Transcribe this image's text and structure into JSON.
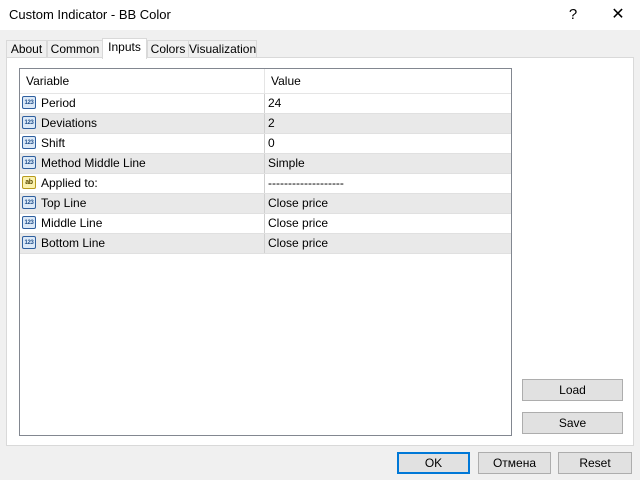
{
  "window": {
    "title": "Custom Indicator - BB Color",
    "help_glyph": "?",
    "close_glyph": "✕"
  },
  "tabs": [
    {
      "label": "About",
      "active": false
    },
    {
      "label": "Common",
      "active": false
    },
    {
      "label": "Inputs",
      "active": true
    },
    {
      "label": "Colors",
      "active": false
    },
    {
      "label": "Visualization",
      "active": false
    }
  ],
  "grid": {
    "headers": {
      "variable": "Variable",
      "value": "Value"
    },
    "rows": [
      {
        "icon": "number-type-icon",
        "icon_text": "123",
        "variable": "Period",
        "value": "24"
      },
      {
        "icon": "number-type-icon",
        "icon_text": "123",
        "variable": "Deviations",
        "value": "2"
      },
      {
        "icon": "number-type-icon",
        "icon_text": "123",
        "variable": "Shift",
        "value": "0"
      },
      {
        "icon": "number-type-icon",
        "icon_text": "123",
        "variable": "Method Middle Line",
        "value": "Simple"
      },
      {
        "icon": "string-type-icon",
        "icon_text": "ab",
        "variable": "Applied to:",
        "value": "-------------------"
      },
      {
        "icon": "number-type-icon",
        "icon_text": "123",
        "variable": "Top Line",
        "value": "Close price"
      },
      {
        "icon": "number-type-icon",
        "icon_text": "123",
        "variable": "Middle Line",
        "value": "Close price"
      },
      {
        "icon": "number-type-icon",
        "icon_text": "123",
        "variable": "Bottom Line",
        "value": "Close price"
      }
    ]
  },
  "side_buttons": {
    "load": "Load",
    "save": "Save"
  },
  "footer": {
    "ok": "OK",
    "cancel": "Отмена",
    "reset": "Reset"
  },
  "colors": {
    "default_button_border": "#0078d7",
    "alt_row": "#e9e9e9",
    "grid_border": "#828790"
  }
}
